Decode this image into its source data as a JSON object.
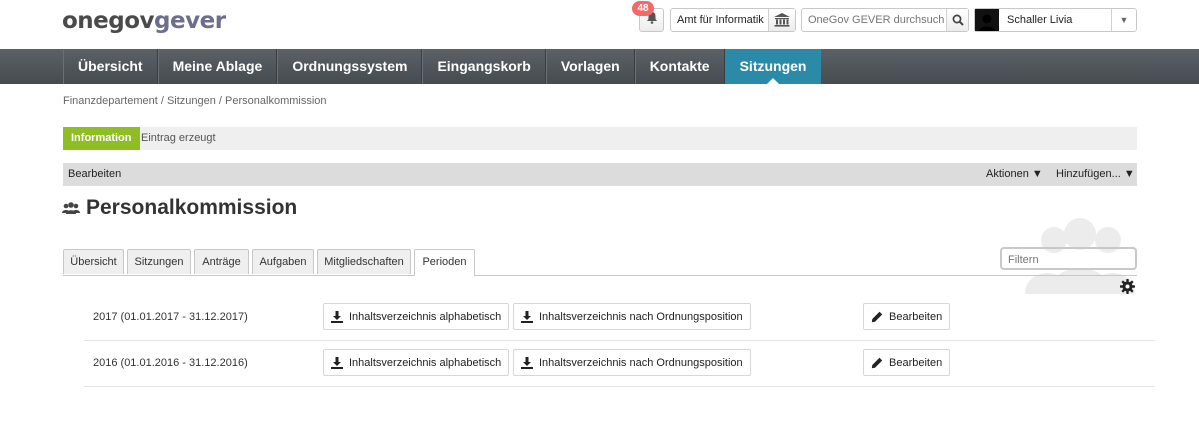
{
  "header": {
    "logo_part1": "onegov",
    "logo_part2": "gever",
    "notifications_count": "48",
    "org_unit": "Amt für Informatik",
    "search_placeholder": "OneGov GEVER durchsuchen",
    "user_name": "Schaller Livia"
  },
  "nav": {
    "items": [
      {
        "label": "Übersicht"
      },
      {
        "label": "Meine Ablage"
      },
      {
        "label": "Ordnungssystem"
      },
      {
        "label": "Eingangskorb"
      },
      {
        "label": "Vorlagen"
      },
      {
        "label": "Kontakte"
      },
      {
        "label": "Sitzungen"
      }
    ],
    "active": "Sitzungen"
  },
  "breadcrumb": "Finanzdepartement / Sitzungen / Personalkommission",
  "status": {
    "label": "Information",
    "text": "Eintrag erzeugt",
    "color": "#8fbe24"
  },
  "actionbar": {
    "edit": "Bearbeiten",
    "actions": "Aktionen ▼",
    "add": "Hinzufügen... ▼"
  },
  "title": "Personalkommission",
  "tabs": [
    {
      "label": "Übersicht"
    },
    {
      "label": "Sitzungen"
    },
    {
      "label": "Anträge"
    },
    {
      "label": "Aufgaben"
    },
    {
      "label": "Mitgliedschaften"
    },
    {
      "label": "Perioden"
    }
  ],
  "active_tab": "Perioden",
  "filter_placeholder": "Filtern",
  "periods": [
    {
      "label": "2017 (01.01.2017 - 31.12.2017)",
      "toc_alpha": "Inhaltsverzeichnis alphabetisch",
      "toc_repo": "Inhaltsverzeichnis nach Ordnungsposition",
      "edit": "Bearbeiten"
    },
    {
      "label": "2016 (01.01.2016 - 31.12.2016)",
      "toc_alpha": "Inhaltsverzeichnis alphabetisch",
      "toc_repo": "Inhaltsverzeichnis nach Ordnungsposition",
      "edit": "Bearbeiten"
    }
  ],
  "colors": {
    "nav_active": "#2b8aa8",
    "badge": "#f06a6a"
  }
}
